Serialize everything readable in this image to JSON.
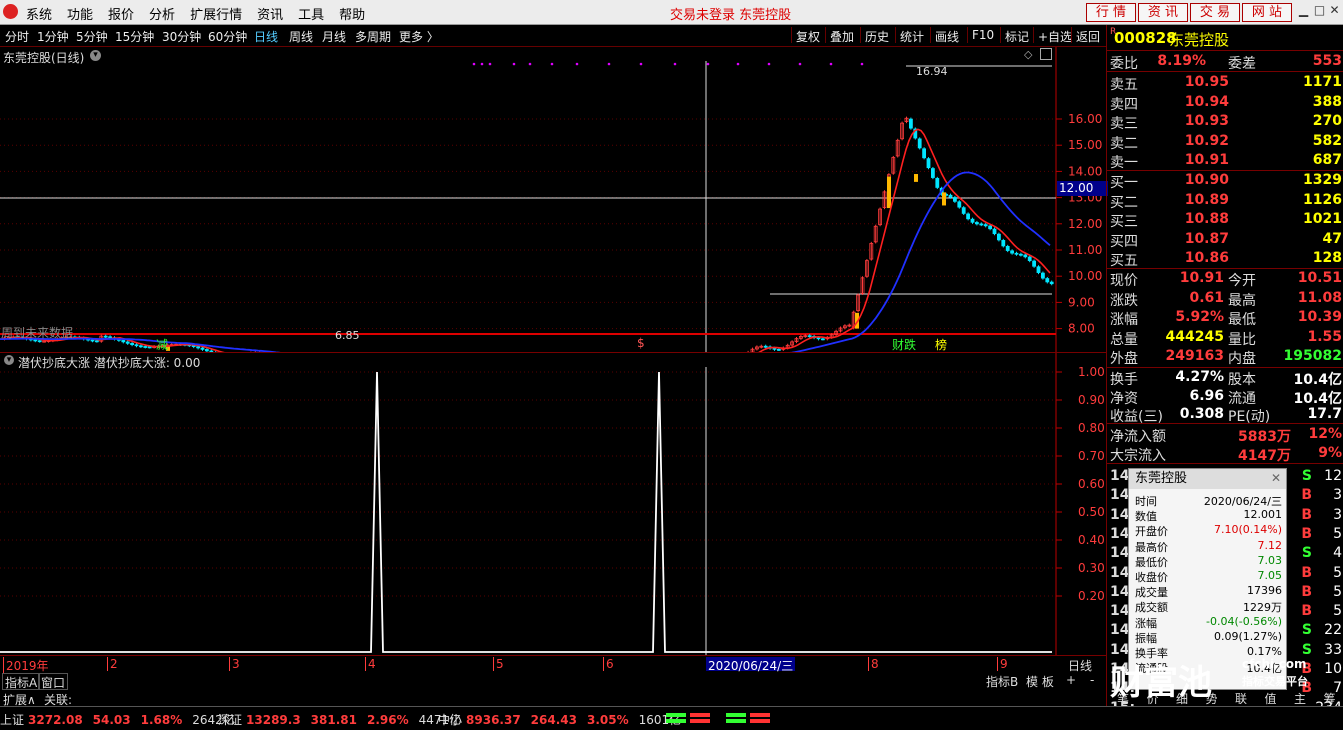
{
  "menubar": {
    "items": [
      "系统",
      "功能",
      "报价",
      "分析",
      "扩展行情",
      "资讯",
      "工具",
      "帮助"
    ],
    "status": "交易未登录  东莞控股",
    "right_buttons": [
      "行 情",
      "资 讯",
      "交 易",
      "网 站"
    ]
  },
  "periods": {
    "items": [
      "分时",
      "1分钟",
      "5分钟",
      "15分钟",
      "30分钟",
      "60分钟",
      "日线",
      "周线",
      "月线",
      "多周期",
      "更多 〉"
    ],
    "active": "日线",
    "tools": [
      "复权",
      "叠加",
      "历史",
      "统计",
      "画线",
      "F10",
      "标记",
      "+自选",
      "返回"
    ]
  },
  "main_chart": {
    "title": "东莞控股(日线)",
    "y_ticks": [
      "16.00",
      "15.00",
      "14.00",
      "13.00",
      "12.00",
      "11.00",
      "10.00",
      "9.00",
      "8.00"
    ],
    "cursor_price": "12.00",
    "high_label": "16.94",
    "low_label": "6.85",
    "future_label": "周到未来数据",
    "markers": [
      {
        "text": "减",
        "color": "#3f3"
      },
      {
        "text": "$",
        "color": "#f55"
      },
      {
        "text": "财跌",
        "color": "#3f3"
      },
      {
        "text": "榜",
        "color": "#ff0"
      }
    ],
    "colors": {
      "ma_short": "#ff2020",
      "ma_long": "#2030ff",
      "up": "#ff3c3c",
      "down": "#00e5ff",
      "grid": "#5a0000"
    }
  },
  "sub_chart": {
    "title": "潜伏抄底大涨  潜伏抄底大涨: 0.00",
    "y_ticks": [
      "1.00",
      "0.90",
      "0.80",
      "0.70",
      "0.60",
      "0.50",
      "0.40",
      "0.30",
      "0.20"
    ]
  },
  "xaxis": {
    "labels": [
      "2019年",
      "2",
      "3",
      "4",
      "5",
      "6",
      "7",
      "8",
      "9"
    ],
    "cursor_date": "2020/06/24/三",
    "right_label": "日线"
  },
  "bottom": {
    "tabs_left": [
      "指标A",
      "窗口"
    ],
    "row2": [
      "扩展∧",
      "关联:"
    ],
    "tabs_right": [
      "指标B",
      "模 板",
      "+",
      "-"
    ]
  },
  "quote": {
    "code": "000828",
    "name": "东莞控股",
    "weibi_label": "委比",
    "weibi": "8.19%",
    "weicha_label": "委差",
    "weicha": "553",
    "sell": [
      {
        "label": "卖五",
        "price": "10.95",
        "vol": "1171"
      },
      {
        "label": "卖四",
        "price": "10.94",
        "vol": "388"
      },
      {
        "label": "卖三",
        "price": "10.93",
        "vol": "270"
      },
      {
        "label": "卖二",
        "price": "10.92",
        "vol": "582"
      },
      {
        "label": "卖一",
        "price": "10.91",
        "vol": "687"
      }
    ],
    "buy": [
      {
        "label": "买一",
        "price": "10.90",
        "vol": "1329"
      },
      {
        "label": "买二",
        "price": "10.89",
        "vol": "1126"
      },
      {
        "label": "买三",
        "price": "10.88",
        "vol": "1021"
      },
      {
        "label": "买四",
        "price": "10.87",
        "vol": "47"
      },
      {
        "label": "买五",
        "price": "10.86",
        "vol": "128"
      }
    ],
    "stats": [
      {
        "l1": "现价",
        "v1": "10.91",
        "c1": "red",
        "l2": "今开",
        "v2": "10.51",
        "c2": "red"
      },
      {
        "l1": "涨跌",
        "v1": "0.61",
        "c1": "red",
        "l2": "最高",
        "v2": "11.08",
        "c2": "red"
      },
      {
        "l1": "涨幅",
        "v1": "5.92%",
        "c1": "red",
        "l2": "最低",
        "v2": "10.39",
        "c2": "red"
      },
      {
        "l1": "总量",
        "v1": "444245",
        "c1": "yellow",
        "l2": "量比",
        "v2": "1.55",
        "c2": "red"
      },
      {
        "l1": "外盘",
        "v1": "249163",
        "c1": "red",
        "l2": "内盘",
        "v2": "195082",
        "c2": "green"
      }
    ],
    "stats2": [
      {
        "l1": "换手",
        "v1": "4.27%",
        "l2": "股本",
        "v2": "10.4亿"
      },
      {
        "l1": "净资",
        "v1": "6.96",
        "l2": "流通",
        "v2": "10.4亿"
      },
      {
        "l1": "收益(三)",
        "v1": "0.308",
        "l2": "PE(动)",
        "v2": "17.7"
      }
    ],
    "flows": [
      {
        "label": "净流入额",
        "value": "5883万",
        "pct": "12%"
      },
      {
        "label": "大宗流入",
        "value": "4147万",
        "pct": "9%"
      }
    ],
    "ticks": [
      {
        "t": "14:",
        "s": "S",
        "n": "12"
      },
      {
        "t": "14:",
        "s": "B",
        "n": "3"
      },
      {
        "t": "14:",
        "s": "B",
        "n": "3"
      },
      {
        "t": "14:",
        "s": "B",
        "n": "5"
      },
      {
        "t": "14:",
        "s": "S",
        "n": "4"
      },
      {
        "t": "14:",
        "s": "B",
        "n": "5"
      },
      {
        "t": "14:",
        "s": "B",
        "n": "5"
      },
      {
        "t": "14:",
        "s": "B",
        "n": "5"
      },
      {
        "t": "14:",
        "s": "S",
        "n": "22"
      },
      {
        "t": "14:",
        "s": "S",
        "n": "33"
      },
      {
        "t": "14:",
        "s": "B",
        "n": "10"
      },
      {
        "t": "14:",
        "s": "B",
        "n": "7"
      },
      {
        "t": "15:",
        "s": "",
        "n": "234"
      }
    ],
    "bottom_tabs": [
      "笔",
      "价",
      "细",
      "势",
      "联",
      "值",
      "主",
      "筹"
    ]
  },
  "popup": {
    "title": "东莞控股",
    "rows": [
      {
        "k": "时间",
        "v": "2020/06/24/三",
        "c": "#000"
      },
      {
        "k": "数值",
        "v": "12.001",
        "c": "#000"
      },
      {
        "k": "开盘价",
        "v": "7.10(0.14%)",
        "c": "#d00"
      },
      {
        "k": "最高价",
        "v": "7.12",
        "c": "#d00"
      },
      {
        "k": "最低价",
        "v": "7.03",
        "c": "#080"
      },
      {
        "k": "收盘价",
        "v": "7.05",
        "c": "#080"
      },
      {
        "k": "成交量",
        "v": "17396",
        "c": "#000"
      },
      {
        "k": "成交额",
        "v": "1229万",
        "c": "#000"
      },
      {
        "k": "涨幅",
        "v": "-0.04(-0.56%)",
        "c": "#080"
      },
      {
        "k": "振幅",
        "v": "0.09(1.27%)",
        "c": "#000"
      },
      {
        "k": "换手率",
        "v": "0.17%",
        "c": "#000"
      },
      {
        "k": "流通股",
        "v": "10.4亿",
        "c": "#000"
      }
    ]
  },
  "watermark": {
    "main": "财富池",
    "site": "cfchi.com",
    "sub": "指标交易平台"
  },
  "indices": [
    {
      "name": "上证",
      "price": "3272.08",
      "chg": "54.03",
      "pct": "1.68%",
      "amt": "2642亿"
    },
    {
      "name": "深证",
      "price": "13289.3",
      "chg": "381.81",
      "pct": "2.96%",
      "amt": "4471亿"
    },
    {
      "name": "中小",
      "price": "8936.37",
      "chg": "264.43",
      "pct": "3.05%",
      "amt": "1601亿"
    }
  ]
}
